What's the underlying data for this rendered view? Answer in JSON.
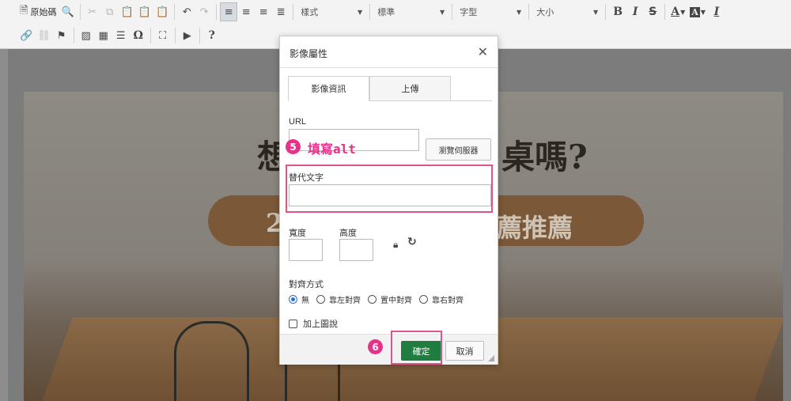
{
  "toolbar": {
    "source_label": "原始碼",
    "format_combo": "樣式",
    "style_combo": "標準",
    "font_combo": "字型",
    "size_combo": "大小",
    "bold": "B",
    "italic": "I",
    "strike": "S",
    "text_color": "A",
    "bg_color": "A",
    "clear_format": "I",
    "special_char": "Ω",
    "help": "?"
  },
  "background": {
    "heading_left": "想",
    "heading_right": "桌嗎?",
    "pill_left": "2",
    "pill_right": "薦推薦"
  },
  "dialog": {
    "title": "影像屬性",
    "close": "✕",
    "tabs": [
      {
        "label": "影像資訊"
      },
      {
        "label": "上傳"
      }
    ],
    "url_label": "URL",
    "url_value": "",
    "browse_label": "瀏覽伺服器",
    "alt_label": "替代文字",
    "alt_value": "",
    "width_label": "寬度",
    "height_label": "高度",
    "width_value": "",
    "height_value": "",
    "align_label": "對齊方式",
    "align_options": [
      {
        "label": "無",
        "selected": true
      },
      {
        "label": "靠左對齊",
        "selected": false
      },
      {
        "label": "置中對齊",
        "selected": false
      },
      {
        "label": "靠右對齊",
        "selected": false
      }
    ],
    "caption_label": "加上圖說",
    "ok_label": "確定",
    "cancel_label": "取消"
  },
  "annotations": {
    "step5_number": "5",
    "step5_text": "填寫alt",
    "step6_number": "6"
  },
  "colors": {
    "ok_button": "#1e7d3f",
    "annotation": "#e6338a"
  }
}
